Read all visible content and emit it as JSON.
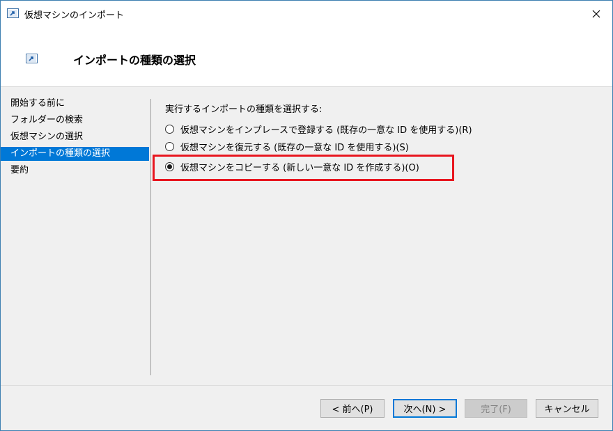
{
  "window": {
    "title": "仮想マシンのインポート"
  },
  "header": {
    "title": "インポートの種類の選択"
  },
  "nav": {
    "items": [
      {
        "label": "開始する前に"
      },
      {
        "label": "フォルダーの検索"
      },
      {
        "label": "仮想マシンの選択"
      },
      {
        "label": "インポートの種類の選択",
        "selected": true
      },
      {
        "label": "要約"
      }
    ]
  },
  "content": {
    "prompt": "実行するインポートの種類を選択する:",
    "options": [
      {
        "label": "仮想マシンをインプレースで登録する (既存の一意な ID を使用する)(R)",
        "checked": false
      },
      {
        "label": "仮想マシンを復元する (既存の一意な ID を使用する)(S)",
        "checked": false
      },
      {
        "label": "仮想マシンをコピーする (新しい一意な ID を作成する)(O)",
        "checked": true
      }
    ]
  },
  "footer": {
    "prev_label": "< 前へ(P)",
    "next_label": "次へ(N) >",
    "finish_label": "完了(F)",
    "cancel_label": "キャンセル"
  },
  "colors": {
    "accent": "#0078d7",
    "highlight": "#e8161f"
  },
  "icons": {
    "app": "import-vm-icon",
    "close": "close-icon"
  }
}
